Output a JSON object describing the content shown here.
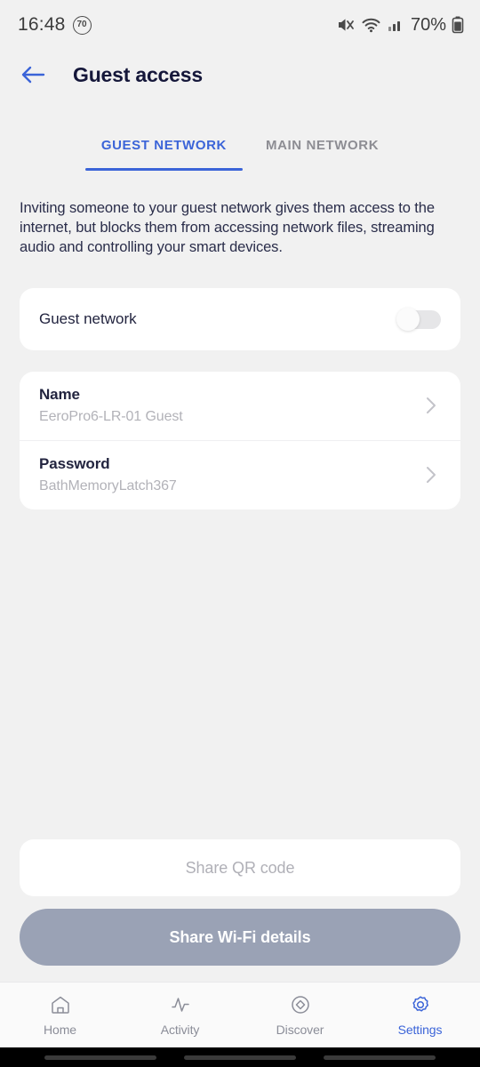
{
  "status_bar": {
    "time": "16:48",
    "speed_badge": "70",
    "battery_text": "70%",
    "icons": [
      "mute-icon",
      "wifi-icon",
      "cellular-signal-icon",
      "battery-icon"
    ]
  },
  "header": {
    "back_icon": "arrow-left-icon",
    "title": "Guest access"
  },
  "tabs": [
    {
      "label": "GUEST NETWORK",
      "active": true
    },
    {
      "label": "MAIN NETWORK",
      "active": false
    }
  ],
  "main": {
    "intro": "Inviting someone to your guest network gives them access to the internet, but blocks them from accessing network files, streaming audio and controlling your smart devices.",
    "toggle_card": {
      "label": "Guest network",
      "state": "off"
    },
    "rows": [
      {
        "title": "Name",
        "value": "EeroPro6-LR-01 Guest"
      },
      {
        "title": "Password",
        "value": "BathMemoryLatch367"
      }
    ]
  },
  "actions": {
    "qr_label": "Share QR code",
    "share_label": "Share Wi-Fi details"
  },
  "bottom_nav": [
    {
      "label": "Home",
      "icon": "home-icon",
      "active": false
    },
    {
      "label": "Activity",
      "icon": "activity-pulse-icon",
      "active": false
    },
    {
      "label": "Discover",
      "icon": "compass-icon",
      "active": false
    },
    {
      "label": "Settings",
      "icon": "gear-icon",
      "active": true
    }
  ],
  "colors": {
    "accent_blue": "#3b64d8",
    "page_background": "#f1f1f1",
    "card_white": "#ffffff",
    "title_navy": "#15173a",
    "muted_gray": "#b2b2b8",
    "share_button": "#9aa2b5"
  }
}
